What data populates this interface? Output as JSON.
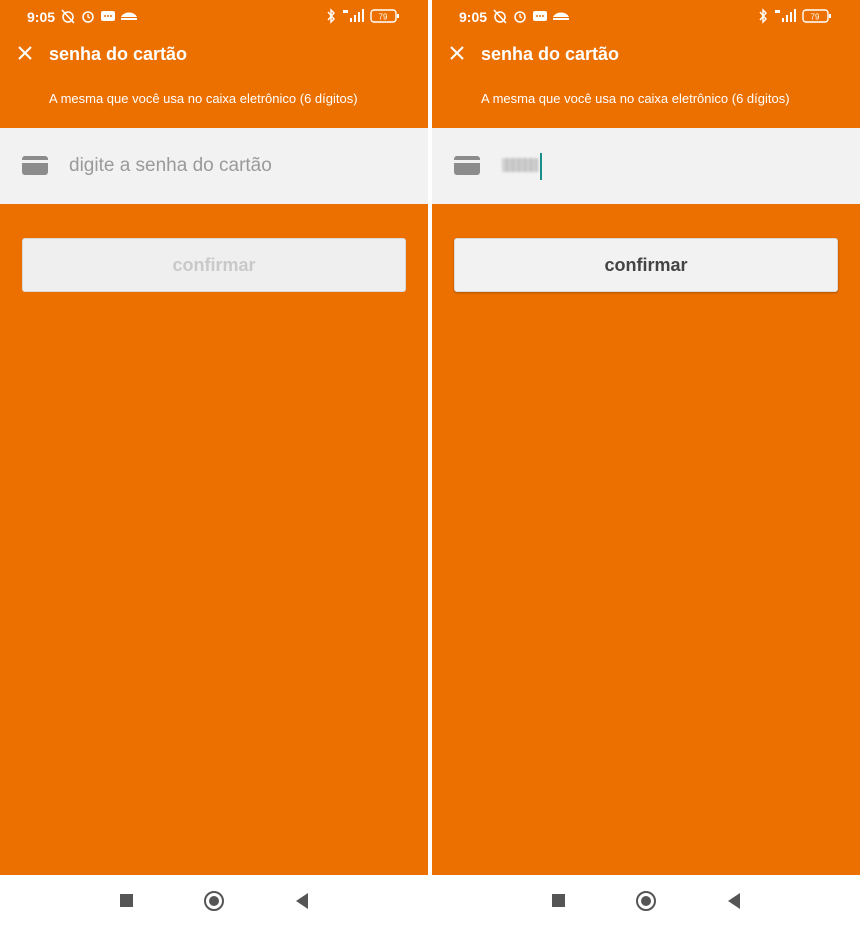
{
  "theme": {
    "brand_orange": "#EC7000",
    "input_bg": "#F2F2F2",
    "cursor_color": "#1a8f8a"
  },
  "screens": [
    {
      "status": {
        "time": "9:05",
        "battery": "79"
      },
      "header": {
        "title": "senha do cartão",
        "close_icon": "close-icon"
      },
      "subtitle": "A mesma que você usa no caixa eletrônico (6 dígitos)",
      "password_field": {
        "placeholder": "digite a senha do cartão",
        "value": "",
        "icon": "card-icon"
      },
      "confirm_button": {
        "label": "confirmar",
        "state": "disabled"
      }
    },
    {
      "status": {
        "time": "9:05",
        "battery": "79"
      },
      "header": {
        "title": "senha do cartão",
        "close_icon": "close-icon"
      },
      "subtitle": "A mesma que você usa no caixa eletrônico (6 dígitos)",
      "password_field": {
        "placeholder": "",
        "value": "masked",
        "icon": "card-icon"
      },
      "confirm_button": {
        "label": "confirmar",
        "state": "enabled"
      }
    }
  ],
  "navbar": {
    "icons": [
      "recents-square-icon",
      "home-circle-icon",
      "back-triangle-icon"
    ]
  }
}
